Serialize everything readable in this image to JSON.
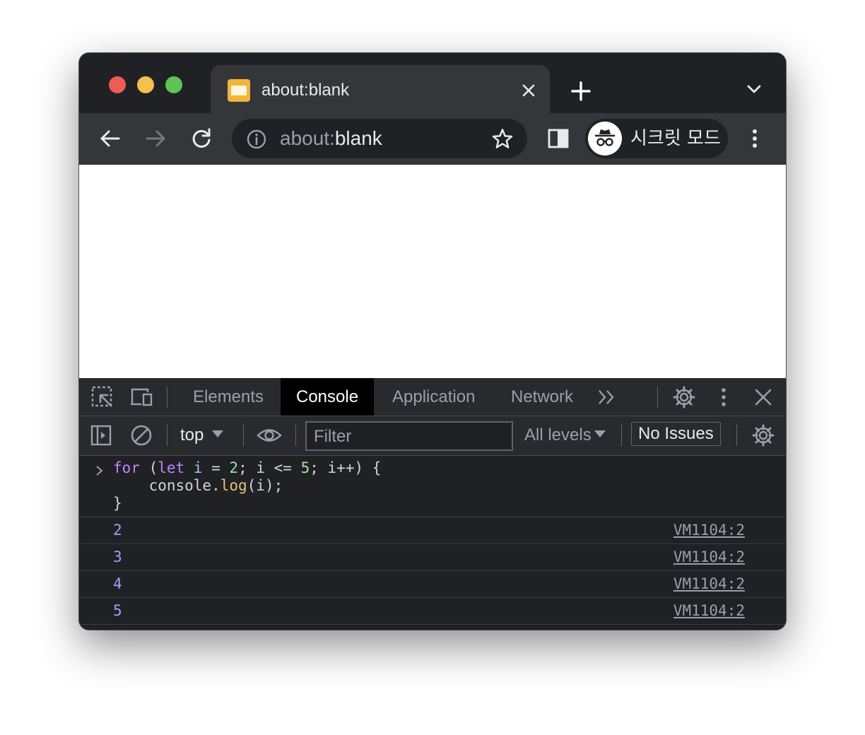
{
  "window": {
    "tab": {
      "title": "about:blank"
    },
    "omnibox": {
      "scheme": "about:",
      "host": "blank"
    },
    "profile": {
      "label": "시크릿 모드"
    }
  },
  "devtools": {
    "tabs": [
      {
        "label": "Elements",
        "active": false
      },
      {
        "label": "Console",
        "active": true
      },
      {
        "label": "Application",
        "active": false
      },
      {
        "label": "Network",
        "active": false
      }
    ],
    "toolbar": {
      "context": "top",
      "filter_placeholder": "Filter",
      "levels": "All levels",
      "issues": "No Issues"
    },
    "console": {
      "input": {
        "line1": {
          "kw_for": "for",
          "p1": " (",
          "kw_let": "let",
          "sp": " ",
          "var_i": "i",
          "p2": " = ",
          "n2": "2",
          "p3": "; i <= ",
          "n5": "5",
          "p4": "; i++) {"
        },
        "line2": {
          "indent": "    console.",
          "fn": "log",
          "rest": "(i);"
        },
        "line3": "}"
      },
      "logs": [
        {
          "value": "2",
          "source": "VM1104:2"
        },
        {
          "value": "3",
          "source": "VM1104:2"
        },
        {
          "value": "4",
          "source": "VM1104:2"
        },
        {
          "value": "5",
          "source": "VM1104:2"
        }
      ]
    }
  },
  "colors": {
    "accent_red": "#ee5c54",
    "accent_yellow": "#f5bf4f",
    "accent_green": "#60c454",
    "favicon": "#f2b53a",
    "log_value": "#a89cff"
  }
}
